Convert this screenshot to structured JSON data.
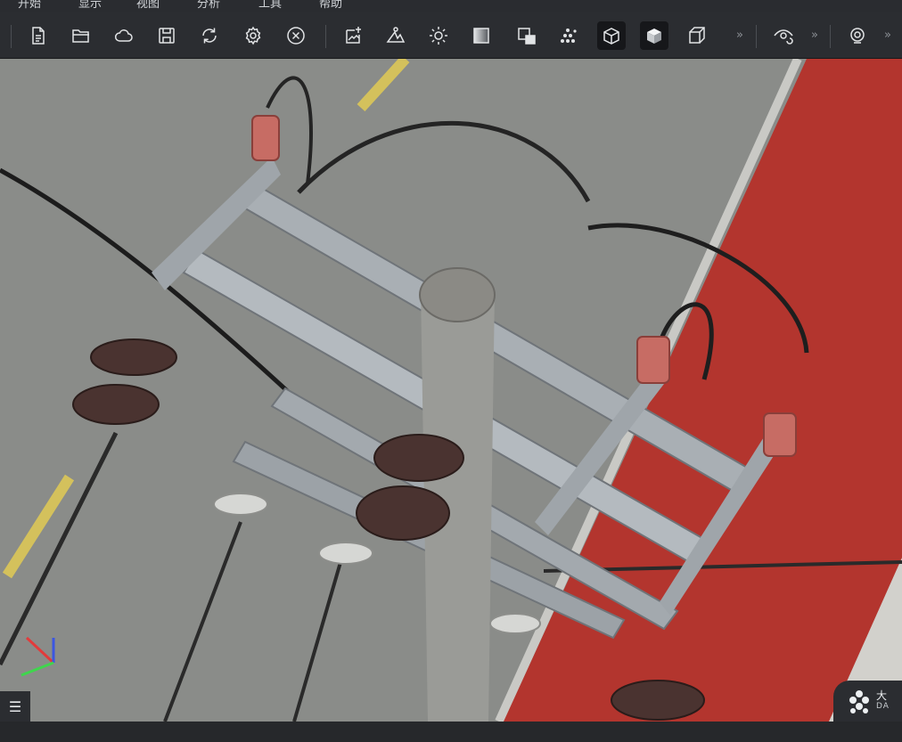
{
  "menu": {
    "items": [
      "开始",
      "显示",
      "视图",
      "分析",
      "工具",
      "帮助"
    ]
  },
  "toolbar": {
    "file_group": [
      "new-file-icon",
      "open-folder-icon",
      "cloud-icon",
      "save-icon",
      "refresh-icon",
      "settings-gear-icon",
      "close-circle-icon"
    ],
    "view_group": [
      "image-import-icon",
      "terrain-icon",
      "light-sun-icon",
      "gradient-icon",
      "layers-icon",
      "point-cloud-icon",
      "wireframe-cube-icon",
      "solid-cube-icon",
      "box-outline-icon"
    ],
    "more": "»",
    "active_buttons": [
      "wireframe-cube-icon",
      "solid-cube-icon"
    ]
  },
  "viewport": {
    "scene": "drone-view-utility-pole-crossarm",
    "panel_toggle": "☰",
    "brand_text_top": "大",
    "brand_text_bottom": "DA"
  },
  "colors": {
    "toolbar_bg": "#2b2d31",
    "road": "#8e8e8c",
    "track_red": "#b5322c",
    "lane_yellow": "#d8c35a"
  }
}
